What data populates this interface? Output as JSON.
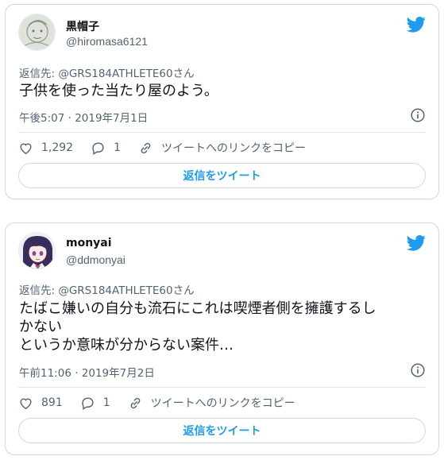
{
  "colors": {
    "accent": "#1d9bf0",
    "secondary": "#536471",
    "text": "#0f1419",
    "border": "#cfd9de"
  },
  "tweets": [
    {
      "display_name": "黒帽子",
      "handle": "@hiromasa6121",
      "reply_prefix": "返信先: ",
      "reply_to": "@GRS184ATHLETE60さん",
      "text": "子供を使った当たり屋のよう。",
      "timestamp": "午後5:07 · 2019年7月1日",
      "likes": "1,292",
      "replies": "1",
      "share_label": "ツイートへのリンクをコピー",
      "reply_button_label": "返信をツイート"
    },
    {
      "display_name": "monyai",
      "handle": "@ddmonyai",
      "reply_prefix": "返信先: ",
      "reply_to": "@GRS184ATHLETE60さん",
      "text": "たばこ嫌いの自分も流石にこれは喫煙者側を擁護するし\nかない\nというか意味が分からない案件…",
      "timestamp": "午前11:06 · 2019年7月2日",
      "likes": "891",
      "replies": "1",
      "share_label": "ツイートへのリンクをコピー",
      "reply_button_label": "返信をツイート"
    }
  ]
}
